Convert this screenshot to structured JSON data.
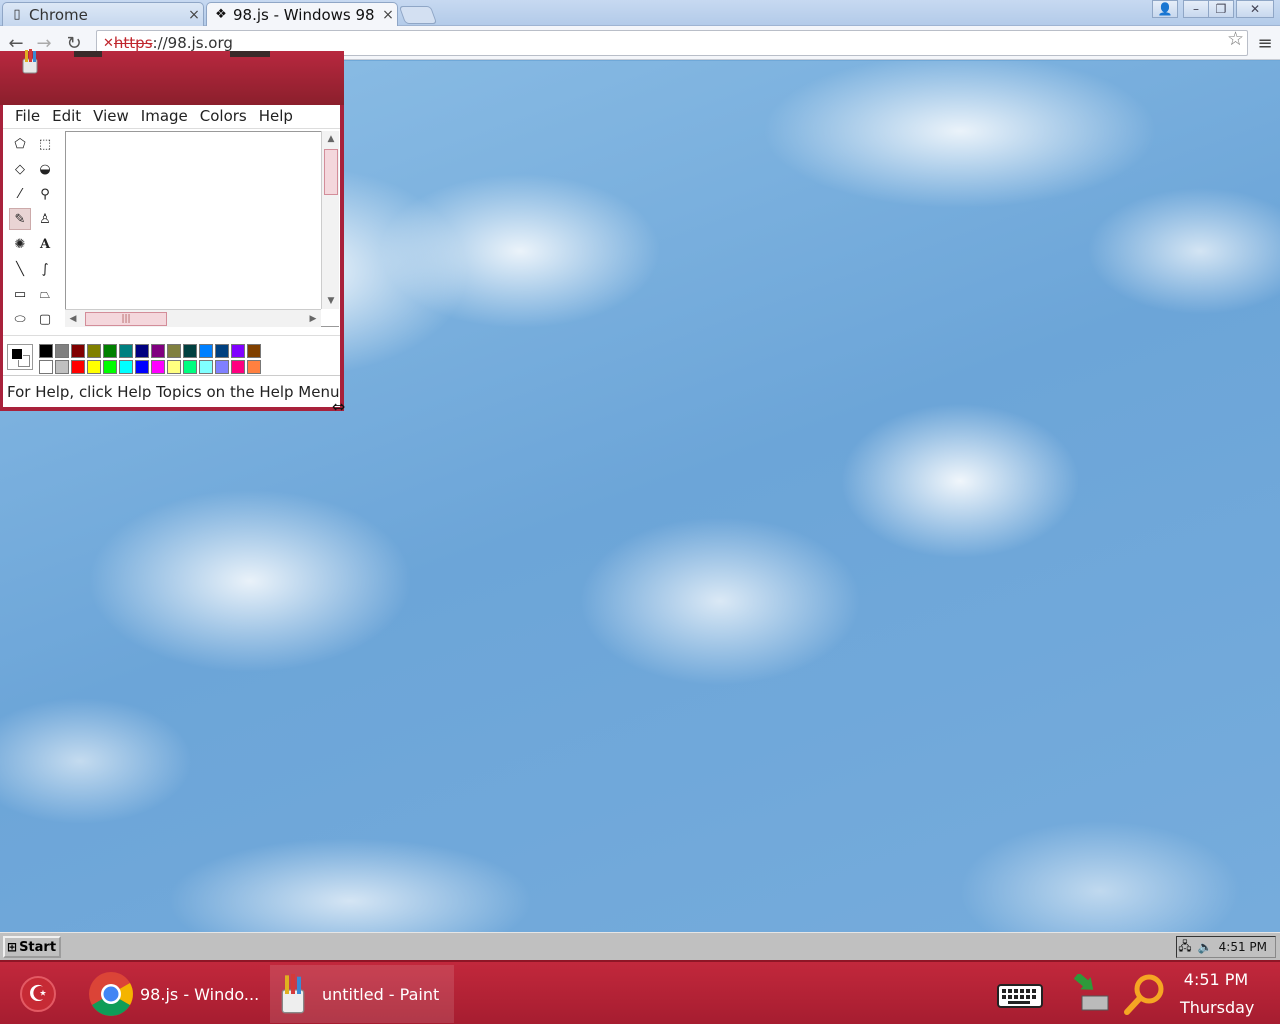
{
  "browser": {
    "tabs": [
      {
        "label": "Chrome"
      },
      {
        "label": "98.js - Windows 98"
      }
    ],
    "url_scheme": "https",
    "url_rest": "://98.js.org"
  },
  "paint": {
    "menu": [
      "File",
      "Edit",
      "View",
      "Image",
      "Colors",
      "Help"
    ],
    "status_text": "For Help, click Help Topics on the Help Menu",
    "palette_top": [
      "#000000",
      "#808080",
      "#800000",
      "#808000",
      "#008000",
      "#008080",
      "#000080",
      "#800080",
      "#808040",
      "#004040",
      "#0080ff",
      "#004080",
      "#8000ff",
      "#804000"
    ],
    "palette_bottom": [
      "#ffffff",
      "#c0c0c0",
      "#ff0000",
      "#ffff00",
      "#00ff00",
      "#00ffff",
      "#0000ff",
      "#ff00ff",
      "#ffff80",
      "#00ff80",
      "#80ffff",
      "#8080ff",
      "#ff0080",
      "#ff8040"
    ]
  },
  "w98_taskbar": {
    "start_label": "Start",
    "time": "4:51 PM"
  },
  "host_taskbar": {
    "tasks": [
      {
        "label": "98.js - Windo..."
      },
      {
        "label": "untitled - Paint"
      }
    ],
    "clock_time": "4:51 PM",
    "clock_day": "Thursday"
  },
  "colors": {
    "accent_red": "#a8213b",
    "sky_blue": "#6fa8d8"
  }
}
